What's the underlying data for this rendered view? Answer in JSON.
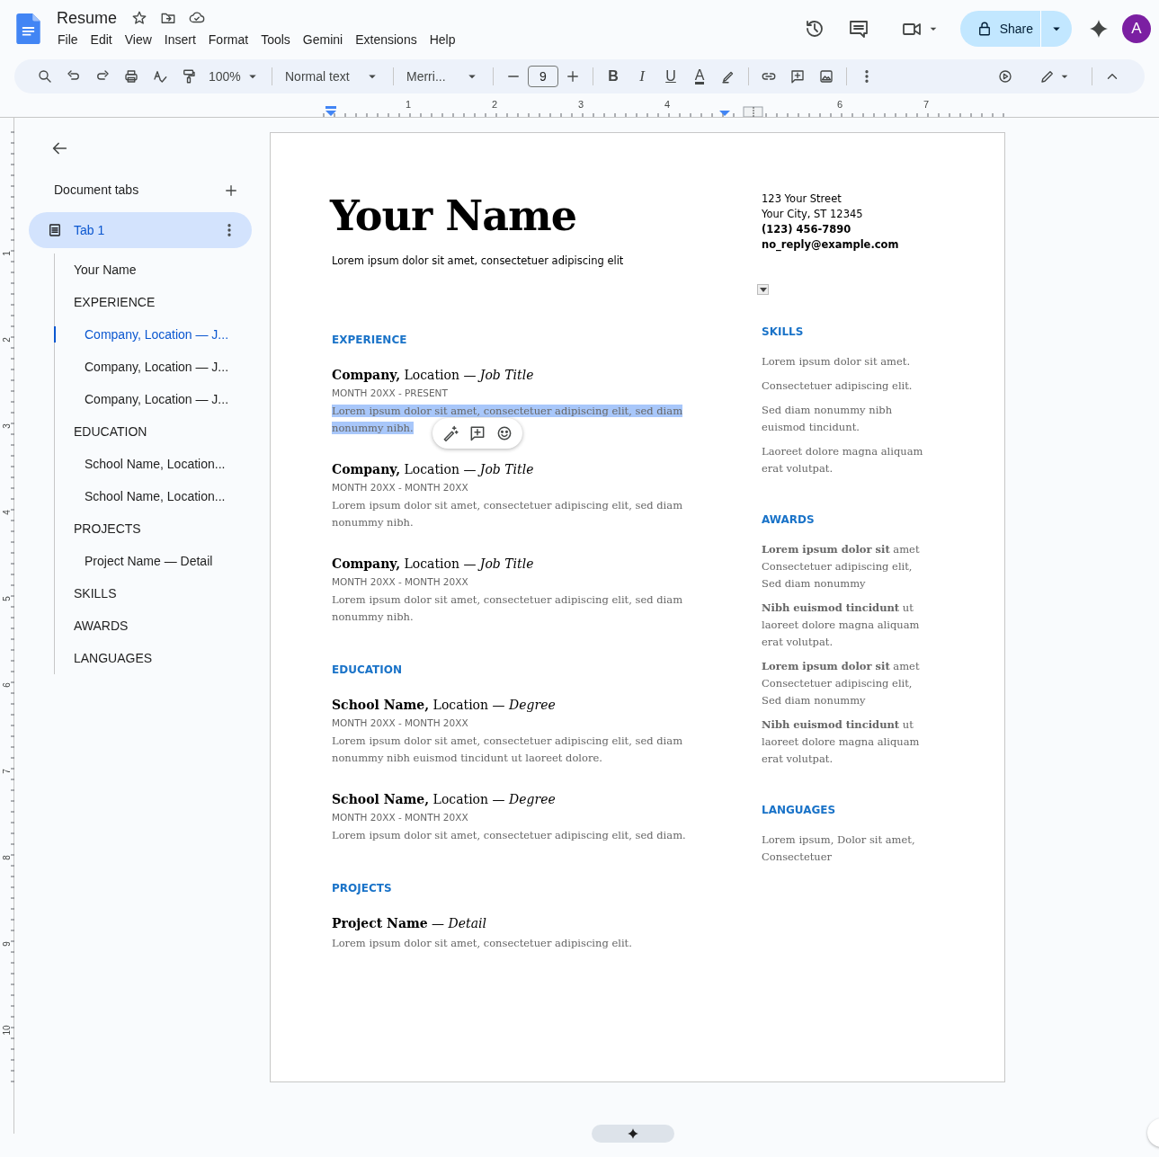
{
  "title": "Resume",
  "menu": [
    "File",
    "Edit",
    "View",
    "Insert",
    "Format",
    "Tools",
    "Gemini",
    "Extensions",
    "Help"
  ],
  "share": {
    "label": "Share"
  },
  "avatar": {
    "letter": "A",
    "color": "#7b1fa2"
  },
  "toolbar": {
    "zoom": "100%",
    "style": "Normal text",
    "font": "Merri...",
    "font_size": "9",
    "format_buttons": [
      "B",
      "I",
      "U",
      "A"
    ]
  },
  "ruler": {
    "labels": [
      "1",
      "2",
      "3",
      "4",
      "6",
      "7"
    ]
  },
  "vertical_ruler": {
    "labels": [
      "1",
      "2",
      "3",
      "4",
      "5",
      "6",
      "7",
      "8",
      "9",
      "10"
    ]
  },
  "sidebar": {
    "heading": "Document tabs",
    "tab": {
      "label": "Tab 1",
      "selected": true
    },
    "outline": [
      {
        "label": "Your Name",
        "selected": false
      },
      {
        "label": "EXPERIENCE",
        "selected": false,
        "children": [
          {
            "label": "Company, Location — J...",
            "selected": true
          },
          {
            "label": "Company, Location — J...",
            "selected": false
          },
          {
            "label": "Company, Location — J...",
            "selected": false
          }
        ]
      },
      {
        "label": "EDUCATION",
        "selected": false,
        "children": [
          {
            "label": "School Name, Location...",
            "selected": false
          },
          {
            "label": "School Name, Location...",
            "selected": false
          }
        ]
      },
      {
        "label": "PROJECTS",
        "selected": false,
        "children": [
          {
            "label": "Project Name — Detail",
            "selected": false
          }
        ]
      },
      {
        "label": "SKILLS",
        "selected": false
      },
      {
        "label": "AWARDS",
        "selected": false
      },
      {
        "label": "LANGUAGES",
        "selected": false
      }
    ]
  },
  "document": {
    "name": "Your Name",
    "tagline": "Lorem ipsum dolor sit amet, consectetuer adipiscing elit",
    "contact": [
      {
        "text": "123 Your Street",
        "bold": false
      },
      {
        "text": "Your City, ST 12345",
        "bold": false
      },
      {
        "text": "(123) 456-7890",
        "bold": true
      },
      {
        "text": "no_reply@example.com",
        "bold": true
      }
    ],
    "main_sections": [
      {
        "heading": "EXPERIENCE",
        "entries": [
          {
            "title": "**Company,** Location — *Job Title*",
            "dates": "MONTH 20XX - PRESENT",
            "text": "Lorem ipsum dolor sit amet, consectetuer adipiscing elit, sed diam nonummy nibh.",
            "highlighted": true
          },
          {
            "title": "**Company,** Location — *Job Title*",
            "dates": "MONTH 20XX - MONTH 20XX",
            "text": "Lorem ipsum dolor sit amet, consectetuer adipiscing elit, sed diam nonummy nibh.",
            "highlighted": false
          },
          {
            "title": "**Company,** Location — *Job Title*",
            "dates": "MONTH 20XX - MONTH 20XX",
            "text": "Lorem ipsum dolor sit amet, consectetuer adipiscing elit, sed diam nonummy nibh.",
            "highlighted": false
          }
        ]
      },
      {
        "heading": "EDUCATION",
        "entries": [
          {
            "title": "**School Name,** Location — *Degree*",
            "dates": "MONTH 20XX - MONTH 20XX",
            "text": "Lorem ipsum dolor sit amet, consectetuer adipiscing elit, sed diam nonummy nibh euismod tincidunt ut laoreet dolore.",
            "highlighted": false
          },
          {
            "title": "**School Name,** Location — *Degree*",
            "dates": "MONTH 20XX - MONTH 20XX",
            "text": "Lorem ipsum dolor sit amet, consectetuer adipiscing elit, sed diam.",
            "highlighted": false
          }
        ]
      },
      {
        "heading": "PROJECTS",
        "entries": [
          {
            "title": "**Project Name** — *Detail*",
            "text": "Lorem ipsum dolor sit amet, consectetuer adipiscing elit.",
            "highlighted": false
          }
        ]
      }
    ],
    "side_sections": [
      {
        "heading": "SKILLS",
        "items": [
          "Lorem ipsum dolor sit amet.",
          "Consectetuer adipiscing elit.",
          "Sed diam nonummy nibh euismod tincidunt.",
          "Laoreet dolore magna aliquam erat volutpat."
        ]
      },
      {
        "heading": "AWARDS",
        "items": [
          "**Lorem ipsum dolor sit** amet Consectetuer adipiscing elit, Sed diam nonummy",
          "**Nibh euismod tincidunt** ut laoreet dolore magna aliquam erat volutpat.",
          "**Lorem ipsum dolor sit** amet Consectetuer adipiscing elit, Sed diam nonummy",
          "**Nibh euismod tincidunt** ut laoreet dolore magna aliquam erat volutpat."
        ]
      },
      {
        "heading": "LANGUAGES",
        "items": [
          "Lorem ipsum, Dolor sit amet, Consectetuer"
        ]
      }
    ]
  }
}
